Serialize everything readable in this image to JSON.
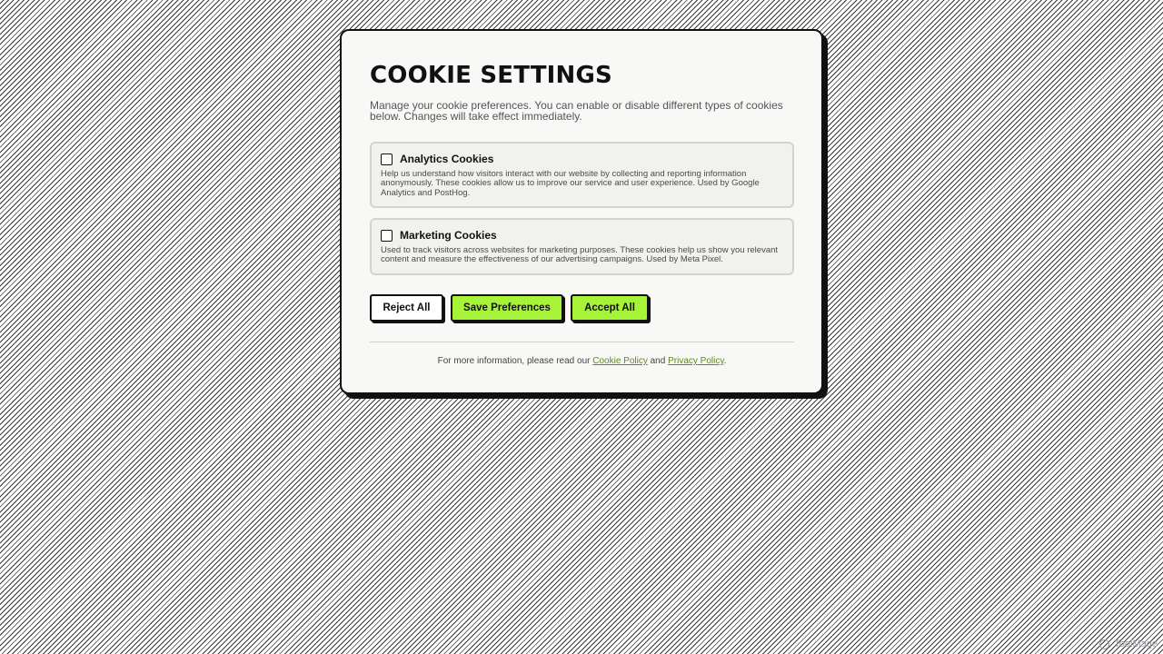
{
  "modal": {
    "title": "COOKIE SETTINGS",
    "intro": "Manage your cookie preferences. You can enable or disable different types of cookies below. Changes will take effect immediately."
  },
  "cookies": [
    {
      "label": "Analytics Cookies",
      "checked": false,
      "description": "Help us understand how visitors interact with our website by collecting and reporting information anonymously. These cookies allow us to improve our service and user experience. Used by Google Analytics and PostHog."
    },
    {
      "label": "Marketing Cookies",
      "checked": false,
      "description": "Used to track visitors across websites for marketing purposes. These cookies help us show you relevant content and measure the effectiveness of our advertising campaigns. Used by Meta Pixel."
    }
  ],
  "actions": {
    "reject_label": "Reject All",
    "save_label": "Save Preferences",
    "accept_label": "Accept All"
  },
  "footer": {
    "prefix": "For more information, please read our ",
    "cookie_policy_label": "Cookie Policy",
    "middle": " and ",
    "privacy_policy_label": "Privacy Policy",
    "suffix": "."
  },
  "watermark": {
    "text": "ToolMage"
  },
  "colors": {
    "accent": "#a6f33a",
    "border": "#111111",
    "link": "#5f8a1c"
  }
}
